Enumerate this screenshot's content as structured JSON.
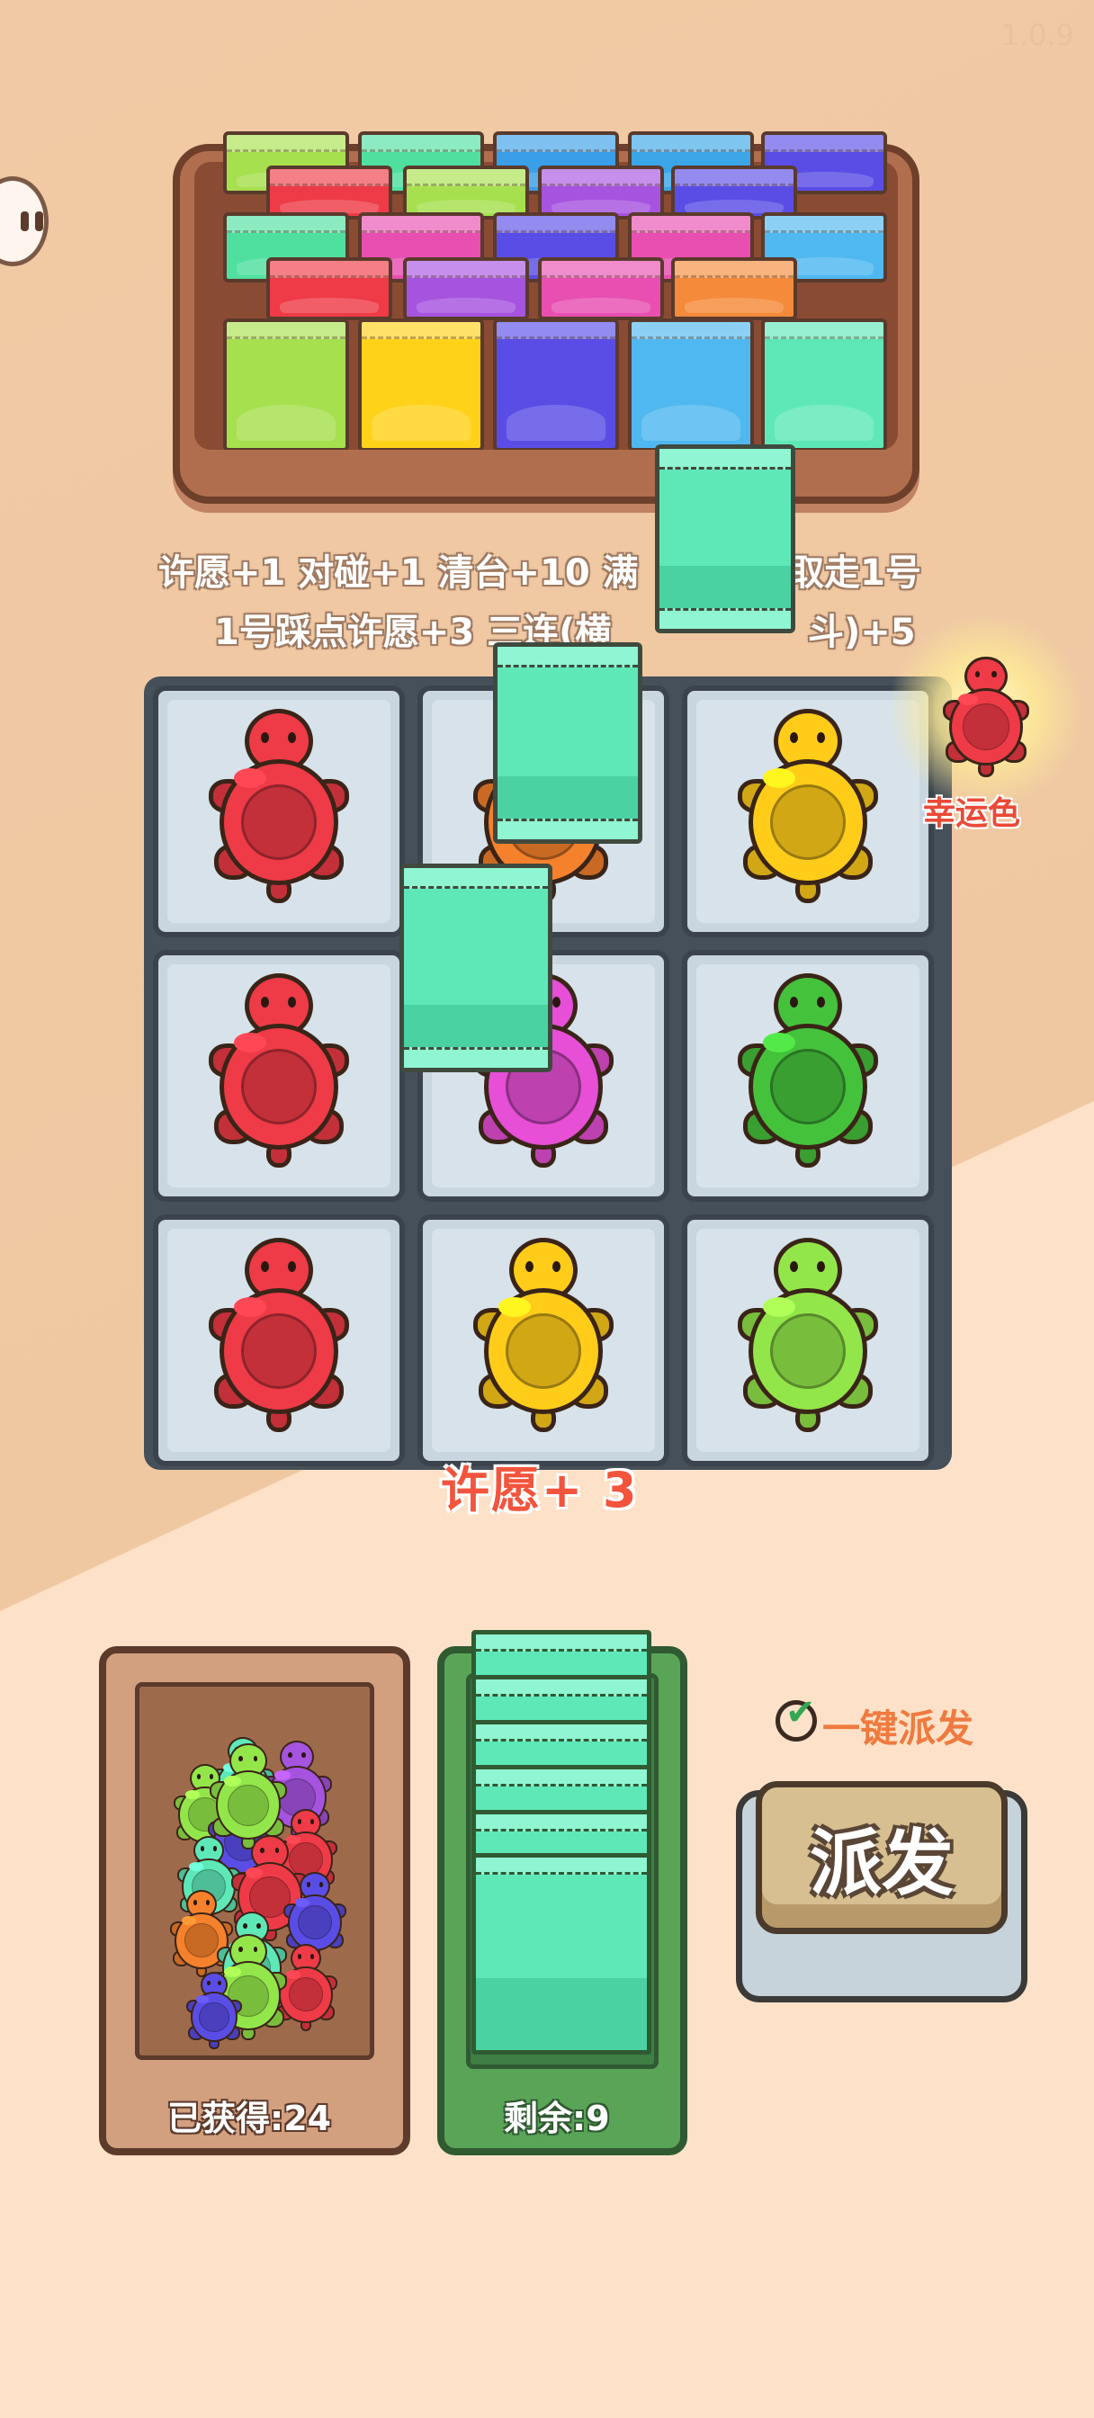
{
  "app": {
    "version": "1.0.9"
  },
  "rules": {
    "line1": "许愿+1 对碰+1 清台+10 满",
    "line1_tail": "取走1号",
    "line2": "1号踩点许愿+3 三连(横",
    "line2_tail": "斗)+5"
  },
  "grid": {
    "cells": [
      {
        "row": 0,
        "col": 0,
        "turtle": "red"
      },
      {
        "row": 0,
        "col": 1,
        "turtle": "orange"
      },
      {
        "row": 0,
        "col": 2,
        "turtle": "yellow"
      },
      {
        "row": 1,
        "col": 0,
        "turtle": "red"
      },
      {
        "row": 1,
        "col": 1,
        "turtle": "magenta"
      },
      {
        "row": 1,
        "col": 2,
        "turtle": "green"
      },
      {
        "row": 2,
        "col": 0,
        "turtle": "red"
      },
      {
        "row": 2,
        "col": 1,
        "turtle": "yellow"
      },
      {
        "row": 2,
        "col": 2,
        "turtle": "lime"
      }
    ],
    "bonus_label": "许愿+ 3"
  },
  "lucky": {
    "label": "幸运色",
    "color": "red"
  },
  "collected": {
    "label": "已获得:24"
  },
  "remaining": {
    "label": "剩余:9"
  },
  "auto_dispatch": {
    "label": "一键派发",
    "checked": true
  },
  "dispatch_button": {
    "label": "派发"
  },
  "colors": {
    "red": "#ee3b47",
    "orange": "#f5812c",
    "yellow": "#ffcc1a",
    "magenta": "#e64fd6",
    "green": "#45c23c",
    "lime": "#93e64a",
    "teal": "#5ee8b8"
  }
}
